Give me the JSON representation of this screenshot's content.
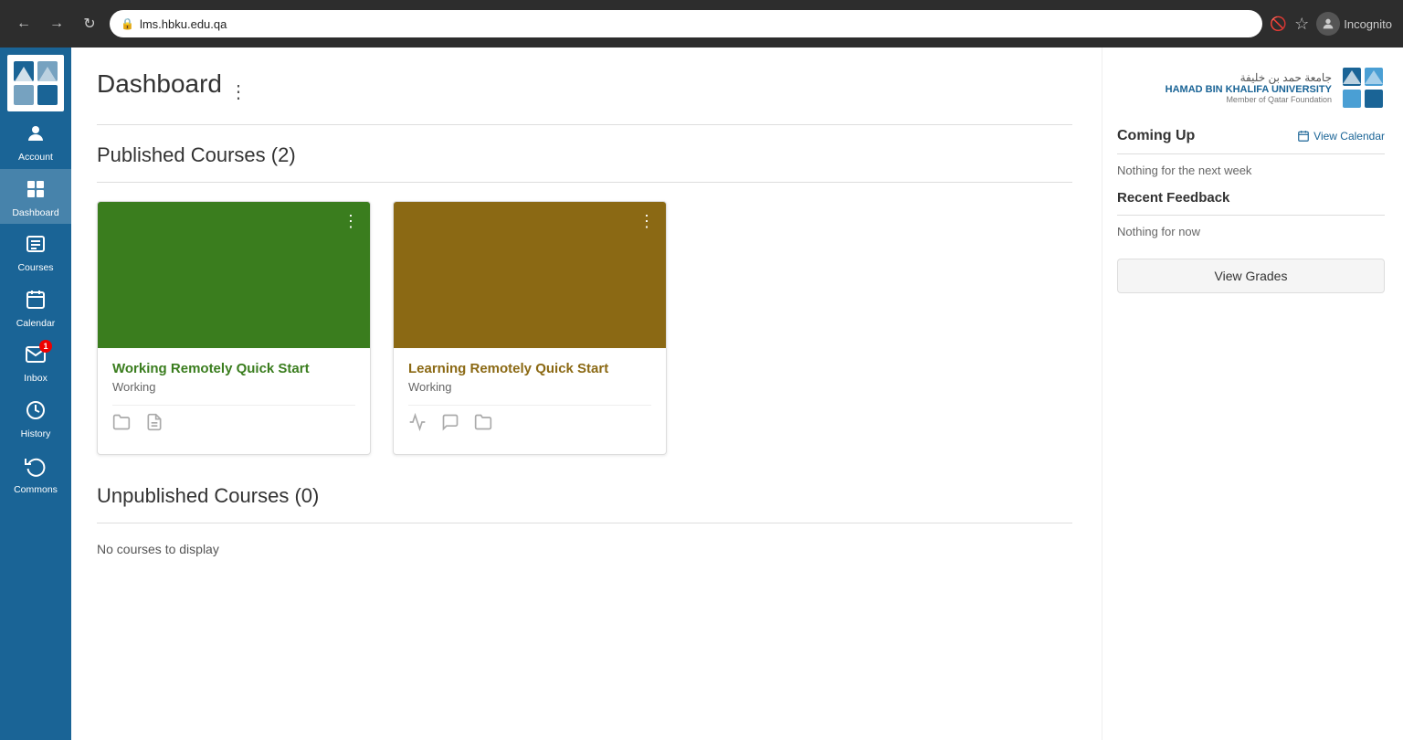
{
  "browser": {
    "url": "lms.hbku.edu.qa",
    "profile": "Incognito"
  },
  "sidebar": {
    "items": [
      {
        "id": "account",
        "label": "Account",
        "icon": "👤"
      },
      {
        "id": "dashboard",
        "label": "Dashboard",
        "icon": "⊞"
      },
      {
        "id": "courses",
        "label": "Courses",
        "icon": "📋"
      },
      {
        "id": "calendar",
        "label": "Calendar",
        "icon": "📅"
      },
      {
        "id": "inbox",
        "label": "Inbox",
        "icon": "💬",
        "badge": "1"
      },
      {
        "id": "history",
        "label": "History",
        "icon": "🕐"
      },
      {
        "id": "commons",
        "label": "Commons",
        "icon": "↩"
      }
    ]
  },
  "dashboard": {
    "title": "Dashboard",
    "menu_icon": "⋮",
    "published_section": {
      "title": "Published Courses (2)",
      "courses": [
        {
          "id": "course-1",
          "name": "Working Remotely Quick Start",
          "status": "Working",
          "color": "green",
          "color_hex": "#3a7d1e",
          "icons": [
            "📁",
            "📝"
          ]
        },
        {
          "id": "course-2",
          "name": "Learning Remotely Quick Start",
          "status": "Working",
          "color": "gold",
          "color_hex": "#8b6914",
          "icons": [
            "📢",
            "💬",
            "📁"
          ]
        }
      ]
    },
    "unpublished_section": {
      "title": "Unpublished Courses (0)",
      "empty_text": "No courses to display"
    }
  },
  "right_panel": {
    "university": {
      "name_ar": "جامعة حمد بن خليفة",
      "name_en": "HAMAD BIN KHALIFA UNIVERSITY",
      "sub": "Member of Qatar Foundation"
    },
    "coming_up": {
      "title": "Coming Up",
      "view_calendar_label": "View Calendar",
      "empty_text": "Nothing for the next week"
    },
    "recent_feedback": {
      "title": "Recent Feedback",
      "empty_text": "Nothing for now"
    },
    "view_grades_label": "View Grades"
  }
}
